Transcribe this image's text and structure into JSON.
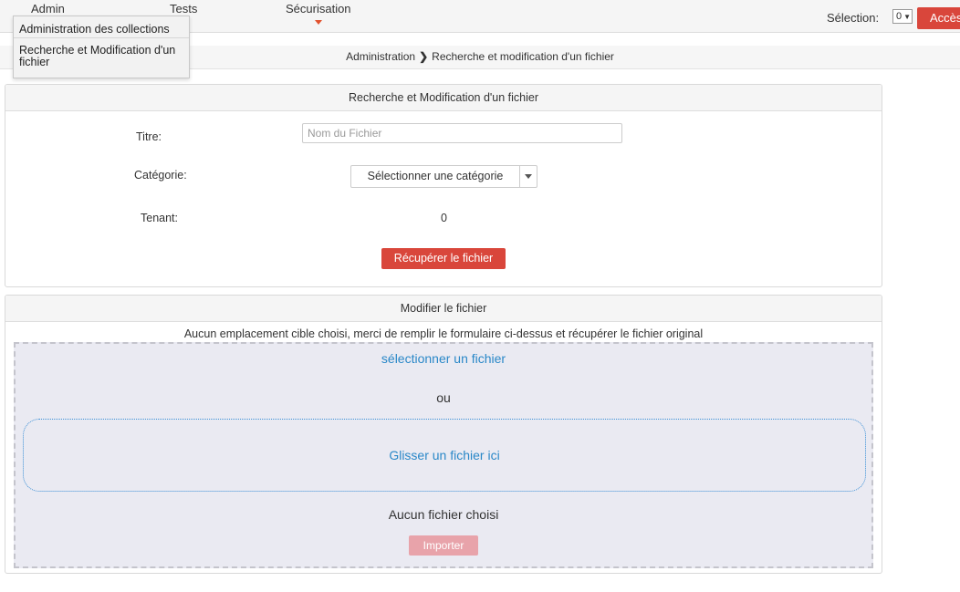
{
  "nav": {
    "items": [
      {
        "label": "Admin"
      },
      {
        "label": "Tests"
      },
      {
        "label": "Sécurisation"
      }
    ],
    "selection_label": "Sélection:",
    "selection_value": "0",
    "access_button": "Accès",
    "accent_color": "#d9463b"
  },
  "dropdown": {
    "items": [
      {
        "label": "Administration des collections"
      },
      {
        "label_line1": "Recherche et Modification d'un",
        "label_line2": "fichier"
      }
    ]
  },
  "breadcrumb": {
    "parent": "Administration",
    "current": "Recherche et modification d'un fichier"
  },
  "search_panel": {
    "title": "Recherche et Modification d'un fichier",
    "title_label": "Titre:",
    "title_placeholder": "Nom du Fichier",
    "title_value": "",
    "category_label": "Catégorie:",
    "category_selected": "Sélectionner une catégorie",
    "tenant_label": "Tenant:",
    "tenant_value": "0",
    "submit_button": "Récupérer le fichier"
  },
  "modify_panel": {
    "title": "Modifier le fichier",
    "info": "Aucun emplacement cible choisi, merci de remplir le formulaire ci-dessus et récupérer le fichier original",
    "select_file_link": "sélectionner un fichier",
    "or_text": "ou",
    "drop_text": "Glisser un fichier ici",
    "no_file_text": "Aucun fichier choisi",
    "import_button": "Importer"
  }
}
